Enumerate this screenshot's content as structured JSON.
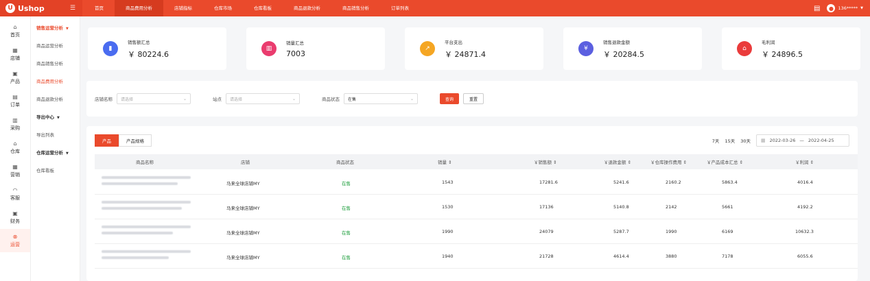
{
  "brand": {
    "name": "Ushop"
  },
  "nav": {
    "items": [
      "首页",
      "商品费用分析",
      "店铺指标",
      "仓库市场",
      "仓库看板",
      "商品退款分析",
      "商品销售分析",
      "订单列表"
    ]
  },
  "user": {
    "name": "136*****"
  },
  "left_rail": [
    "首页",
    "店铺",
    "产品",
    "订单",
    "采购",
    "仓库",
    "营销",
    "客服",
    "财务",
    "运营"
  ],
  "submenu": {
    "group1": "销售运营分析",
    "items1": [
      "商品运营分析",
      "商品销售分析",
      "商品费用分析",
      "商品退款分析"
    ],
    "group2": "导出中心",
    "items2": [
      "导出列表"
    ],
    "group3": "仓库运营分析",
    "items3": [
      "仓库看板"
    ]
  },
  "kpis": [
    {
      "label": "销售额汇总",
      "value": "￥ 80224.6",
      "color": "#4a6cf0",
      "icon": "bar-chart-icon"
    },
    {
      "label": "销量汇总",
      "value": "7003",
      "color": "#ea3c6e",
      "icon": "grid-chart-icon"
    },
    {
      "label": "平台支出",
      "value": "￥ 24871.4",
      "color": "#f5a623",
      "icon": "trend-icon"
    },
    {
      "label": "销售退款金额",
      "value": "￥ 20284.5",
      "color": "#5b5fe0",
      "icon": "refund-icon"
    },
    {
      "label": "毛利润",
      "value": "￥ 24896.5",
      "color": "#ea3c3c",
      "icon": "home-icon"
    }
  ],
  "filter": {
    "shop_label": "店铺名称",
    "shop_placeholder": "请选择",
    "site_label": "站点",
    "site_placeholder": "请选择",
    "status_label": "商品状态",
    "status_value": "在售",
    "query": "查询",
    "reset": "重置"
  },
  "tabs": [
    "产品",
    "产品规格"
  ],
  "range": {
    "d7": "7天",
    "d15": "15天",
    "d30": "30天",
    "start": "2022-03-26",
    "sep": "—",
    "end": "2022-04-25"
  },
  "columns": [
    "商品名称",
    "店铺",
    "商品状态",
    "销量 ⇕",
    "￥销售额 ⇕",
    "￥退款金额 ⇕",
    "￥仓库操作费用 ⇕",
    "￥产品成本汇总 ⇕",
    "￥利润 ⇕"
  ],
  "rows": [
    {
      "shop": "马来全球店铺MY",
      "status": "在售",
      "sales": "1543",
      "revenue": "17281.6",
      "refund": "5241.6",
      "warehouse": "2160.2",
      "cost": "5863.4",
      "profit": "4016.4"
    },
    {
      "shop": "马来全球店铺MY",
      "status": "在售",
      "sales": "1530",
      "revenue": "17136",
      "refund": "5140.8",
      "warehouse": "2142",
      "cost": "5661",
      "profit": "4192.2"
    },
    {
      "shop": "马来全球店铺MY",
      "status": "在售",
      "sales": "1990",
      "revenue": "24079",
      "refund": "5287.7",
      "warehouse": "1990",
      "cost": "6169",
      "profit": "10632.3"
    },
    {
      "shop": "马来全球店铺MY",
      "status": "在售",
      "sales": "1940",
      "revenue": "21728",
      "refund": "4614.4",
      "warehouse": "3880",
      "cost": "7178",
      "profit": "6055.6"
    }
  ]
}
